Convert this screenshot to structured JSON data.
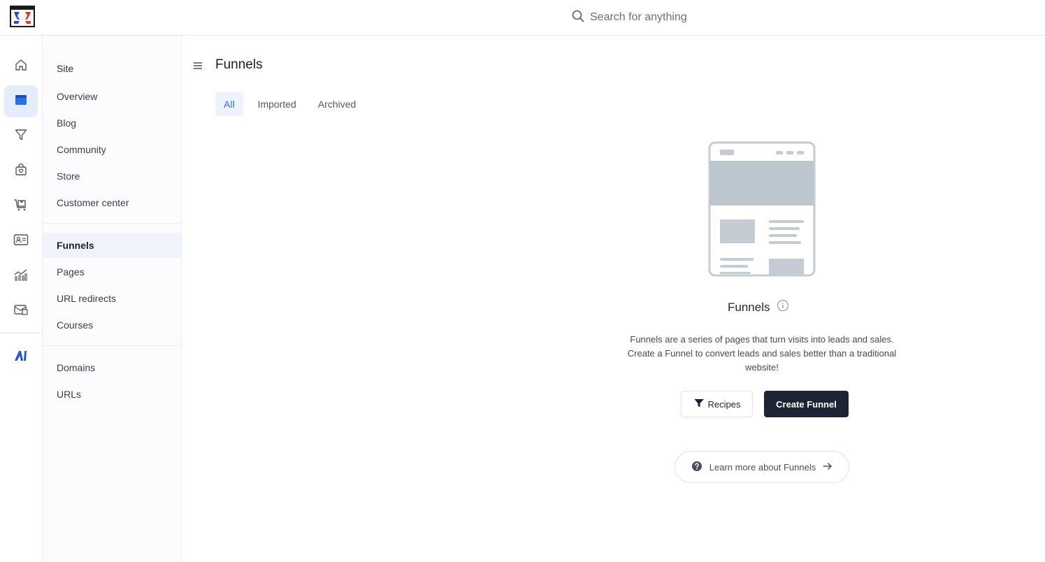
{
  "header": {
    "search_placeholder": "Search for anything"
  },
  "rail": {
    "items": [
      {
        "icon": "home-icon"
      },
      {
        "icon": "site-icon",
        "active": true
      },
      {
        "icon": "funnel-icon"
      },
      {
        "icon": "store-icon"
      },
      {
        "icon": "cart-icon"
      },
      {
        "icon": "contacts-icon"
      },
      {
        "icon": "analytics-icon"
      },
      {
        "icon": "email-icon"
      }
    ],
    "ai_label": "AI"
  },
  "subnav": {
    "heading": "Site",
    "group1": [
      "Overview",
      "Blog",
      "Community",
      "Store",
      "Customer center"
    ],
    "group2": [
      "Funnels",
      "Pages",
      "URL redirects",
      "Courses"
    ],
    "group3": [
      "Domains",
      "URLs"
    ]
  },
  "main": {
    "title": "Funnels",
    "tabs": [
      "All",
      "Imported",
      "Archived"
    ],
    "active_tab": "All"
  },
  "empty_state": {
    "title": "Funnels",
    "description": "Funnels are a series of pages that turn visits into leads and sales. Create a Funnel to convert leads and sales better than a traditional website!",
    "recipes_label": "Recipes",
    "create_label": "Create Funnel",
    "learn_more_label": "Learn more about Funnels"
  },
  "colors": {
    "accent": "#2f6fe0",
    "primary_button": "#1e2433",
    "active_rail_bg": "#e5ecfb"
  }
}
